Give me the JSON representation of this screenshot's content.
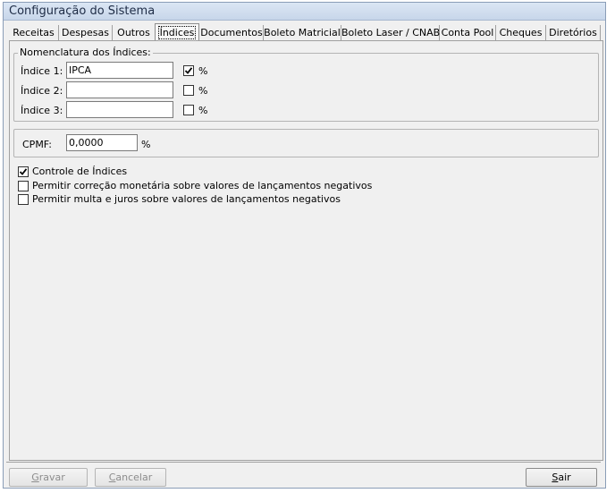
{
  "window": {
    "title": "Configuração do Sistema"
  },
  "tabs": [
    {
      "label": "Receitas"
    },
    {
      "label": "Despesas"
    },
    {
      "label": "Outros"
    },
    {
      "label": "Índices",
      "active": true
    },
    {
      "label": "Documentos"
    },
    {
      "label": "Boleto Matricial"
    },
    {
      "label": "Boleto Laser / CNAB"
    },
    {
      "label": "Conta Pool"
    },
    {
      "label": "Cheques"
    },
    {
      "label": "Diretórios"
    }
  ],
  "indices_group": {
    "legend": "Nomenclatura dos Índices:",
    "rows": [
      {
        "label": "Índice 1:",
        "value": "IPCA",
        "percent_checked": true,
        "percent_label": "%"
      },
      {
        "label": "Índice 2:",
        "value": "",
        "percent_checked": false,
        "percent_label": "%"
      },
      {
        "label": "Índice 3:",
        "value": "",
        "percent_checked": false,
        "percent_label": "%"
      }
    ]
  },
  "cpmf": {
    "label": "CPMF:",
    "value": "0,0000",
    "unit": "%"
  },
  "options": [
    {
      "label": "Controle de Índices",
      "checked": true
    },
    {
      "label": "Permitir correção monetária sobre valores de lançamentos negativos",
      "checked": false
    },
    {
      "label": "Permitir multa e juros sobre valores de lançamentos negativos",
      "checked": false
    }
  ],
  "buttons": {
    "gravar": {
      "prefix": "",
      "mnemonic": "G",
      "rest": "ravar",
      "disabled": true
    },
    "cancelar": {
      "prefix": "",
      "mnemonic": "C",
      "rest": "ancelar",
      "disabled": true
    },
    "sair": {
      "prefix": "",
      "mnemonic": "S",
      "rest": "air",
      "disabled": false
    }
  }
}
